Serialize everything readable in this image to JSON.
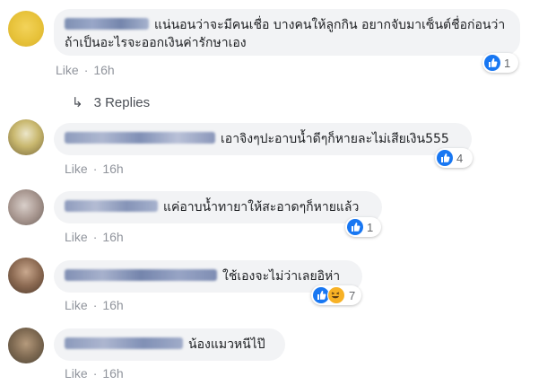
{
  "comments": [
    {
      "text": "แน่นอนว่าจะมีคนเชื่อ บางคนให้ลูกกิน อยากจับมาเซ็นต์ชื่อก่อนว่าถ้าเป็นอะไรจะออกเงินค่ารักษาเอง",
      "like_label": "Like",
      "time": "16h",
      "reaction_count": "1",
      "reply_label": "3 Replies"
    },
    {
      "text": "เอาจิงๆปะอาบน้ำดีๆก็หายละไม่เสียเงิน555",
      "like_label": "Like",
      "time": "16h",
      "reaction_count": "4"
    },
    {
      "text": "แค่อาบน้ำทายาให้สะอาดๆก็หายแล้ว",
      "like_label": "Like",
      "time": "16h",
      "reaction_count": "1"
    },
    {
      "text": "ใช้เองจะไม่ว่าเลยอิห่า",
      "like_label": "Like",
      "time": "16h",
      "reaction_count": "7"
    },
    {
      "text": "น้องแมวหนีไป๊",
      "like_label": "Like",
      "time": "16h"
    }
  ],
  "colors": {
    "bubble": "#f2f3f5",
    "meta": "#90949c",
    "like_reaction": "#1877f2",
    "haha_reaction": "#f7b125"
  },
  "icons": [
    "like-reaction-icon",
    "haha-reaction-icon",
    "reply-arrow-icon"
  ]
}
